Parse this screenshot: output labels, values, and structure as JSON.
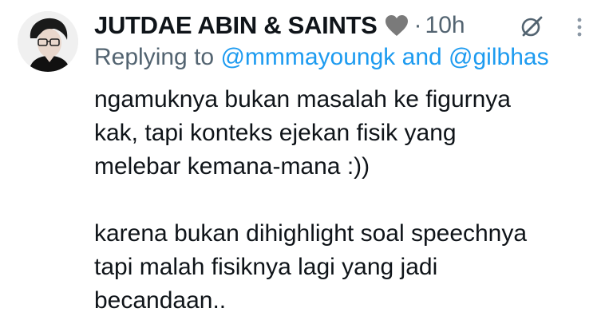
{
  "author": {
    "display_name": "JUTDAE ABIN & SAINTS",
    "badge_emoji": "grey-heart-icon",
    "separator": "·",
    "timestamp": "10h"
  },
  "reply": {
    "prefix": "Replying to",
    "mention_1": "@mmmayoungk",
    "connector": "and",
    "mention_2": "@gilbhas"
  },
  "body": {
    "paragraph_1": {
      "line_1": "ngamuknya bukan masalah ke figurnya",
      "line_2": "kak, tapi konteks ejekan fisik yang",
      "line_3": "melebar kemana-mana :))"
    },
    "paragraph_2": {
      "line_1": "karena bukan dihighlight soal speechnya",
      "line_2": "tapi malah fisiknya lagi yang jadi",
      "line_3": "becandaan.."
    }
  },
  "icons": {
    "grok": "grok-icon",
    "more": "more-options-icon"
  },
  "colors": {
    "text": "#0f1419",
    "secondary": "#536471",
    "link": "#1d9bf0",
    "heart": "#7a7a7a"
  }
}
